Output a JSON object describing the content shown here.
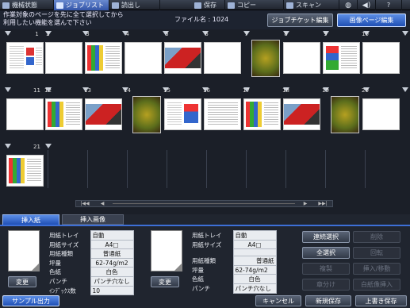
{
  "top_tabs": [
    {
      "label": "機械状態",
      "active": false
    },
    {
      "label": "ジョブリスト",
      "active": true
    },
    {
      "label": "読出し",
      "active": false
    },
    {
      "label": "保存",
      "active": false
    },
    {
      "label": "コピー",
      "active": false
    },
    {
      "label": "スキャン",
      "active": false
    }
  ],
  "header": {
    "instruction_line1": "作業対象のページを先に全て選択してから",
    "instruction_line2": "利用したい機能を選んで下さい",
    "file_name": "ファイル名 : 1024",
    "job_ticket_label": "ジョブチケット編集",
    "image_page_label": "画像ページ編集"
  },
  "pages_row1": [
    "1",
    "2",
    "3",
    "4",
    "5",
    "6",
    "7",
    "8",
    "9",
    "10"
  ],
  "pages_row2": [
    "11",
    "12",
    "13",
    "14",
    "15",
    "16",
    "17",
    "18",
    "19",
    "20"
  ],
  "pages_row3": [
    "21"
  ],
  "scroll": {
    "first": "|◀◀",
    "prev": "◀",
    "next": "▶",
    "last": "▶▶|"
  },
  "panel_tabs": {
    "insert_paper": "挿入紙",
    "insert_image": "挿入画像"
  },
  "insert_paper": {
    "change_label": "変更",
    "rows": [
      {
        "k": "用紙トレイ",
        "v": "自動"
      },
      {
        "k": "用紙サイズ",
        "v": "A4□"
      },
      {
        "k": "用紙種類",
        "v": "普通紙"
      },
      {
        "k": "坪量",
        "v": "62-74g/m2"
      },
      {
        "k": "色紙",
        "v": "白色"
      },
      {
        "k": "パンチ",
        "v": "パンチ穴なし"
      },
      {
        "k": "ｲﾝﾃﾞｯｸｽ数",
        "v": "10"
      }
    ]
  },
  "insert_image": {
    "change_label": "変更",
    "rows": [
      {
        "k": "用紙トレイ",
        "v": "自動"
      },
      {
        "k": "用紙サイズ",
        "v": "A4□"
      },
      {
        "k": "",
        "v": ""
      },
      {
        "k": "用紙種類",
        "v": "普通紙"
      },
      {
        "k": "坪量",
        "v": "62-74g/m2"
      },
      {
        "k": "色紙",
        "v": "白色"
      },
      {
        "k": "パンチ",
        "v": "パンチ穴なし"
      }
    ]
  },
  "right_buttons": {
    "continuous_select": "連続選択",
    "delete": "削除",
    "select_all": "全選択",
    "rotate": "回転",
    "duplicate": "複製",
    "insert_move": "挿入/移動",
    "chapter": "章分け",
    "blank_insert": "白紙像挿入"
  },
  "bottom": {
    "sample_output": "サンプル出力",
    "cancel": "キャンセル",
    "new_save": "新規保存",
    "overwrite_save": "上書き保存"
  }
}
